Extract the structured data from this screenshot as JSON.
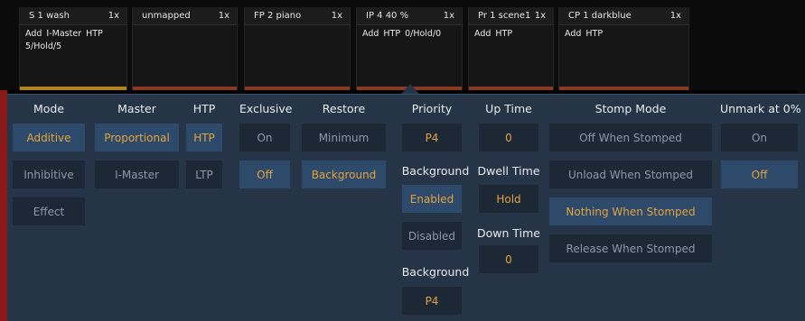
{
  "faders": [
    {
      "name": "S 1 wash",
      "level": "1x",
      "tags": [
        "Add",
        "I-Master",
        "HTP",
        "5/Hold/5"
      ],
      "bar": "gold"
    },
    {
      "name": "unmapped",
      "level": "1x",
      "tags": [],
      "bar": "red"
    },
    {
      "name": "FP 2 piano",
      "level": "1x",
      "tags": [],
      "bar": "red"
    },
    {
      "name": "IP 4 40 %",
      "level": "1x",
      "tags": [
        "Add",
        "HTP",
        "0/Hold/0"
      ],
      "bar": "red"
    },
    {
      "name": "Pr 1 scene1",
      "level": "1x",
      "tags": [
        "Add",
        "HTP"
      ],
      "bar": "red"
    },
    {
      "name": "CP 1 darkblue",
      "level": "1x",
      "tags": [
        "Add",
        "HTP"
      ],
      "bar": "red"
    }
  ],
  "popup": {
    "mode": {
      "title": "Mode",
      "options": [
        "Additive",
        "Inhibitive",
        "Effect"
      ],
      "selected": "Additive"
    },
    "master": {
      "title": "Master",
      "options": [
        "Proportional",
        "I-Master"
      ],
      "selected": "Proportional"
    },
    "htp": {
      "title": "HTP",
      "options": [
        "HTP",
        "LTP"
      ],
      "selected": "HTP"
    },
    "exclusive": {
      "title": "Exclusive",
      "options": [
        "On",
        "Off"
      ],
      "selected": "Off"
    },
    "restore": {
      "title": "Restore",
      "options": [
        "Minimum",
        "Background"
      ],
      "selected": "Background"
    },
    "priority": {
      "title": "Priority",
      "value": "P4"
    },
    "background": {
      "title": "Background",
      "options": [
        "Enabled",
        "Disabled"
      ],
      "selected": "Enabled"
    },
    "background_priority": {
      "title": "Background",
      "value": "P4"
    },
    "up_time": {
      "title": "Up Time",
      "value": "0"
    },
    "dwell_time": {
      "title": "Dwell Time",
      "value": "Hold"
    },
    "down_time": {
      "title": "Down Time",
      "value": "0"
    },
    "stomp_mode": {
      "title": "Stomp Mode",
      "options": [
        "Off When Stomped",
        "Unload When Stomped",
        "Nothing When Stomped",
        "Release When Stomped"
      ],
      "selected": "Nothing When Stomped"
    },
    "unmark": {
      "title": "Unmark at 0%",
      "options": [
        "On",
        "Off"
      ],
      "selected": "Off"
    }
  },
  "colors": {
    "accent": "#e3a33b",
    "selected_bg": "#2d4a6b",
    "button_bg": "#1c2836",
    "panel_bg": "#253447"
  }
}
